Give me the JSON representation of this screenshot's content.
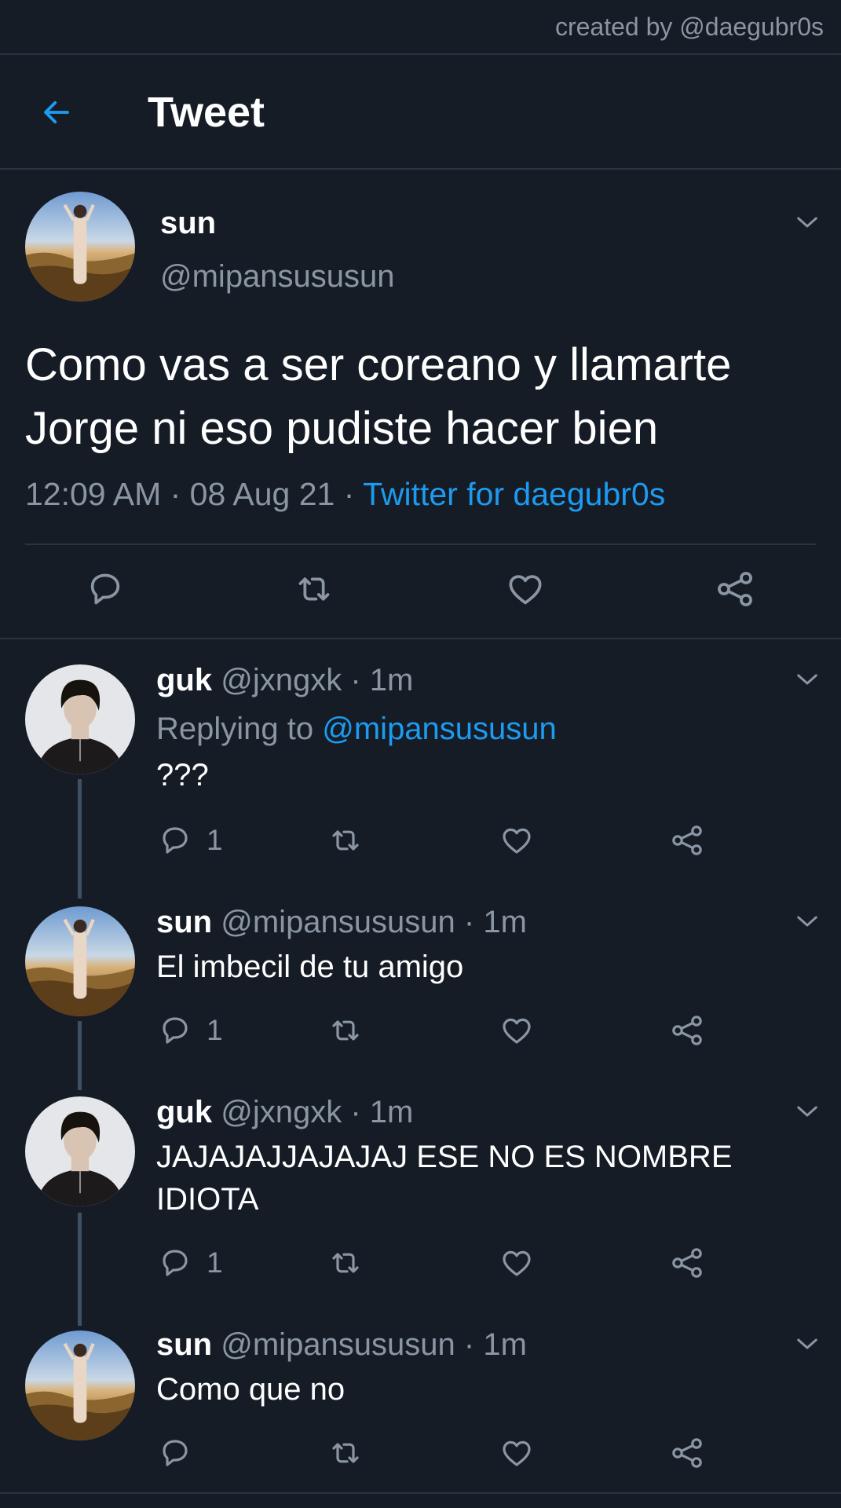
{
  "credit": "created by @daegubr0s",
  "header": {
    "title": "Tweet",
    "back_icon": "arrow-left-icon"
  },
  "colors": {
    "background": "#151c26",
    "accent": "#1d9bf0",
    "muted": "#8a96a3",
    "divider": "#2a3440",
    "thread_line": "#3d5066"
  },
  "main_tweet": {
    "name": "sun",
    "handle": "@mipansususun",
    "text": "Como vas a ser coreano y llamarte Jorge ni eso pudiste hacer bien",
    "time": "12:09 AM",
    "date": "08 Aug 21",
    "source": "Twitter for daegubr0s",
    "actions": [
      "reply-icon",
      "retweet-icon",
      "like-icon",
      "share-icon"
    ]
  },
  "replies": [
    {
      "name": "guk",
      "handle": "@jxngxk",
      "time": "1m",
      "replying_to_label": "Replying to",
      "replying_to": "@mipansususun",
      "text": "???",
      "reply_count": "1"
    },
    {
      "name": "sun",
      "handle": "@mipansususun",
      "time": "1m",
      "text": "El imbecil de tu amigo",
      "reply_count": "1"
    },
    {
      "name": "guk",
      "handle": "@jxngxk",
      "time": "1m",
      "text": "JAJAJAJJAJAJAJ ESE NO ES NOMBRE IDIOTA",
      "reply_count": "1"
    },
    {
      "name": "sun",
      "handle": "@mipansususun",
      "time": "1m",
      "text": "Como que no",
      "reply_count": ""
    }
  ]
}
